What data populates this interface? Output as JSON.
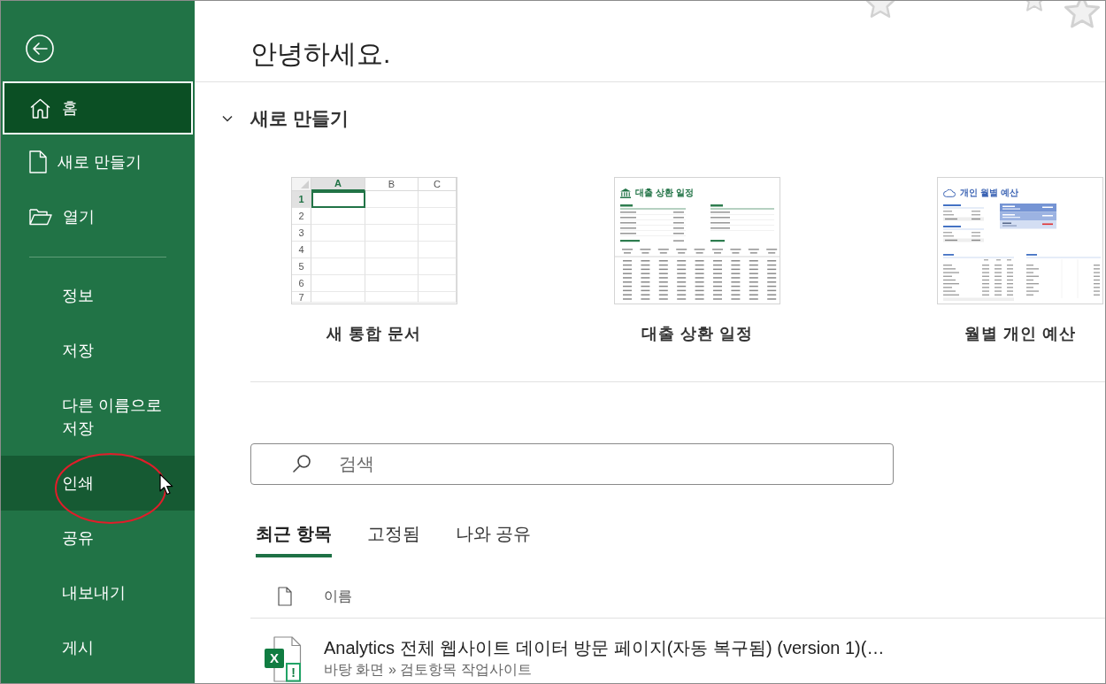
{
  "sidebar": {
    "items": [
      {
        "label": "홈",
        "kind": "home",
        "selected": true,
        "hovered": false,
        "circled": false
      },
      {
        "label": "새로 만들기",
        "kind": "new",
        "selected": false,
        "hovered": false,
        "circled": false
      },
      {
        "label": "열기",
        "kind": "open",
        "selected": false,
        "hovered": false,
        "circled": false
      },
      {
        "label": "정보",
        "kind": "command",
        "selected": false,
        "hovered": false,
        "circled": false
      },
      {
        "label": "저장",
        "kind": "command",
        "selected": false,
        "hovered": false,
        "circled": false
      },
      {
        "label": "다른 이름으로 저장",
        "kind": "command",
        "selected": false,
        "hovered": false,
        "circled": false
      },
      {
        "label": "인쇄",
        "kind": "command",
        "selected": false,
        "hovered": true,
        "circled": true
      },
      {
        "label": "공유",
        "kind": "command",
        "selected": false,
        "hovered": false,
        "circled": false
      },
      {
        "label": "내보내기",
        "kind": "command",
        "selected": false,
        "hovered": false,
        "circled": false
      },
      {
        "label": "게시",
        "kind": "command",
        "selected": false,
        "hovered": false,
        "circled": false
      }
    ]
  },
  "greeting": "안녕하세요.",
  "new_section": {
    "title": "새로 만들기",
    "expanded": true,
    "templates": [
      {
        "name": "새 통합 문서",
        "kind": "blank",
        "columns": [
          {
            "label": "A",
            "selected": true
          },
          {
            "label": "B",
            "selected": false
          },
          {
            "label": "C",
            "selected": false
          }
        ],
        "rows": [
          {
            "label": "1",
            "selected": true
          },
          {
            "label": "2",
            "selected": false
          },
          {
            "label": "3",
            "selected": false
          },
          {
            "label": "4",
            "selected": false
          },
          {
            "label": "5",
            "selected": false
          },
          {
            "label": "6",
            "selected": false
          },
          {
            "label": "7",
            "selected": false
          }
        ]
      },
      {
        "name": "대출 상환 일정",
        "kind": "loan",
        "preview_title": "대출 상환 일정"
      },
      {
        "name": "월별 개인 예산",
        "kind": "budget",
        "preview_title": "개인 월별 예산"
      }
    ]
  },
  "search": {
    "placeholder": "검색"
  },
  "tabs": [
    {
      "label": "최근 항목",
      "selected": true
    },
    {
      "label": "고정됨",
      "selected": false
    },
    {
      "label": "나와 공유",
      "selected": false
    }
  ],
  "file_list": {
    "columns": [
      {
        "label": "이름"
      }
    ],
    "files": [
      {
        "name": "Analytics 전체 웹사이트 데이터 방문 페이지(자동 복구됨) (version 1)(…",
        "location": "바탕 화면 » 검토항목 작업사이트",
        "icon_letter": "X",
        "status_mark": "!"
      }
    ]
  }
}
